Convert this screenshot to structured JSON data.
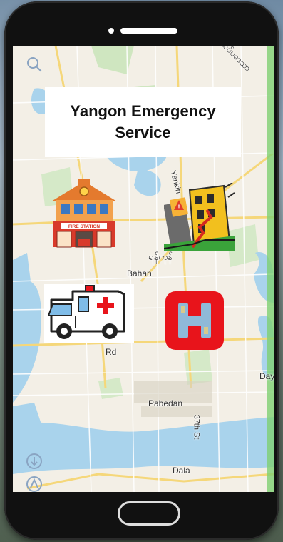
{
  "app": {
    "title_line1": "Yangon Emergency",
    "title_line2": "Service"
  },
  "map_labels": {
    "bahan": "Bahan",
    "pabedan": "Pabedan",
    "dala": "Dala",
    "yankin": "Yankin",
    "street_37": "37th St",
    "rd": "Rd",
    "day": "Day",
    "burmese_1": "ရန်ကုန်",
    "burmese_2": "ထိပ်ပဒေသာ"
  },
  "services": [
    {
      "id": "fire-station",
      "label": "FIRE STATION"
    },
    {
      "id": "disaster",
      "label": ""
    },
    {
      "id": "ambulance",
      "label": ""
    },
    {
      "id": "hospital",
      "label": "H"
    }
  ],
  "colors": {
    "hospital_red": "#e8141b",
    "fire_red": "#d83a2b",
    "building_yellow": "#f2c01e",
    "water": "#a9d3ec",
    "map_bg": "#f3efe6"
  }
}
